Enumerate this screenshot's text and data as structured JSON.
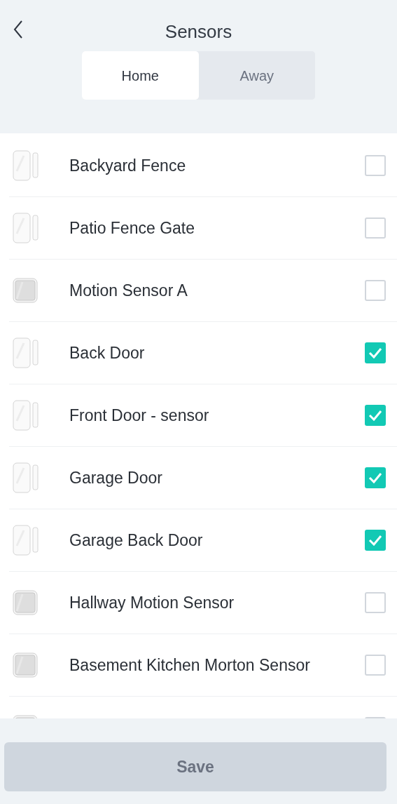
{
  "header": {
    "title": "Sensors"
  },
  "tabs": [
    {
      "label": "Home",
      "selected": true
    },
    {
      "label": "Away",
      "selected": false
    }
  ],
  "sensors": [
    {
      "kind": "contact",
      "name": "Backyard Fence",
      "checked": false
    },
    {
      "kind": "contact",
      "name": "Patio Fence Gate",
      "checked": false
    },
    {
      "kind": "motion",
      "name": "Motion Sensor A",
      "checked": false
    },
    {
      "kind": "contact",
      "name": "Back Door",
      "checked": true
    },
    {
      "kind": "contact",
      "name": "Front Door - sensor",
      "checked": true
    },
    {
      "kind": "contact",
      "name": "Garage Door",
      "checked": true
    },
    {
      "kind": "contact",
      "name": "Garage Back Door",
      "checked": true
    },
    {
      "kind": "motion",
      "name": "Hallway Motion Sensor",
      "checked": false
    },
    {
      "kind": "motion",
      "name": "Basement Kitchen Morton Sensor",
      "checked": false
    },
    {
      "kind": "motion",
      "checked": false
    }
  ],
  "save_button": {
    "label": "Save",
    "disabled": true
  }
}
